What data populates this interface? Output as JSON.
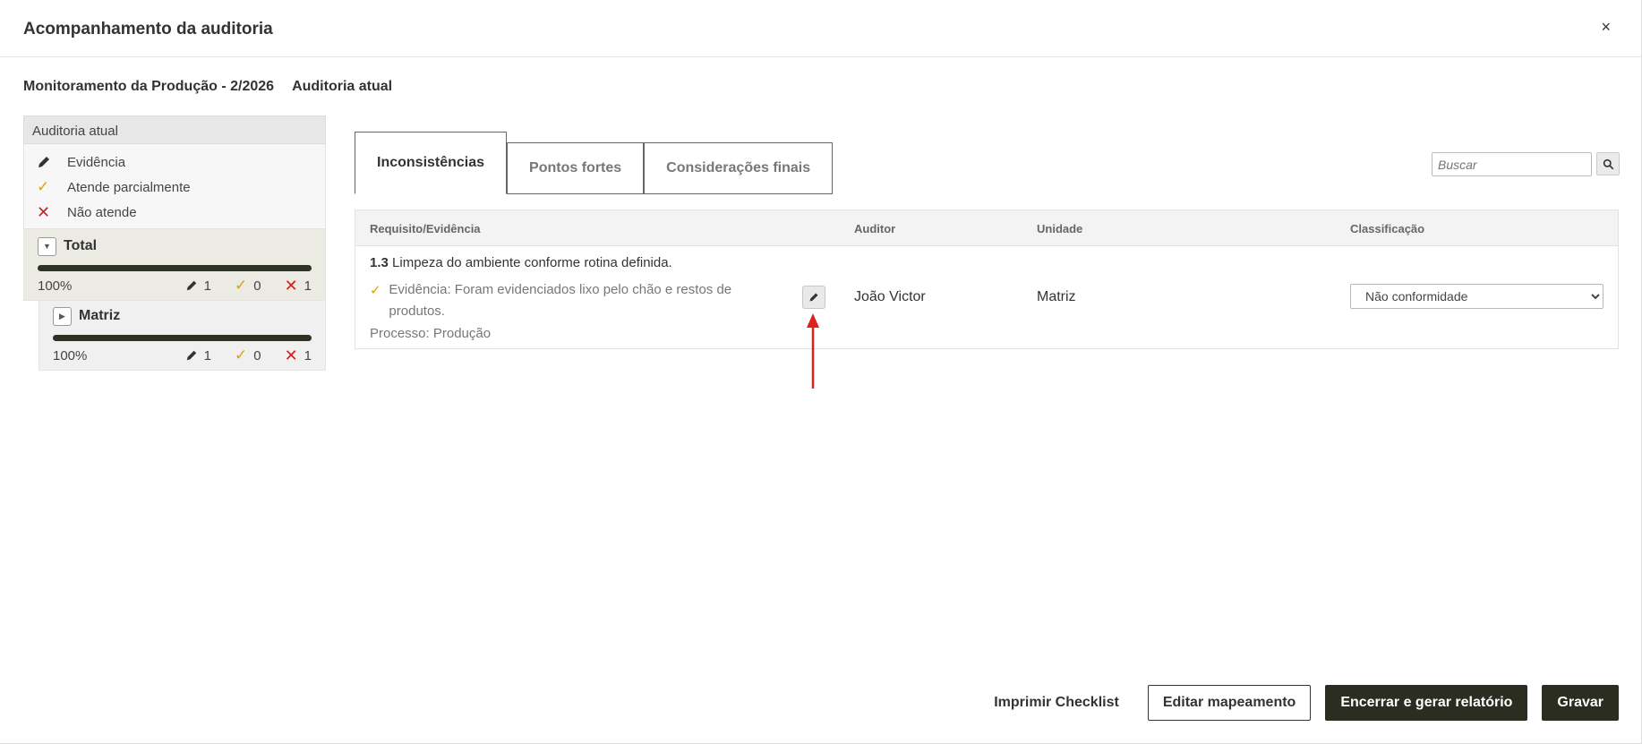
{
  "modal": {
    "title": "Acompanhamento da auditoria",
    "close_label": "×"
  },
  "breadcrumb": {
    "program": "Monitoramento da Produção - 2/2026",
    "audit": "Auditoria atual"
  },
  "left_panel": {
    "header": "Auditoria atual",
    "legend": [
      {
        "icon": "pencil-icon",
        "label": "Evidência"
      },
      {
        "icon": "check-icon",
        "label": "Atende parcialmente"
      },
      {
        "icon": "x-icon",
        "label": "Não atende"
      }
    ],
    "total": {
      "label": "Total",
      "percent": "100%",
      "progress": 1.0,
      "evidence_count": "1",
      "partial_count": "0",
      "fail_count": "1"
    },
    "matriz": {
      "label": "Matriz",
      "percent": "100%",
      "progress": 1.0,
      "evidence_count": "1",
      "partial_count": "0",
      "fail_count": "1"
    }
  },
  "tabs": [
    {
      "label": "Inconsistências",
      "active": true
    },
    {
      "label": "Pontos fortes",
      "active": false
    },
    {
      "label": "Considerações finais",
      "active": false
    }
  ],
  "search": {
    "placeholder": "Buscar"
  },
  "table": {
    "columns": [
      "Requisito/Evidência",
      "Auditor",
      "Unidade",
      "Classificação"
    ],
    "rows": [
      {
        "req_number": "1.3",
        "req_text": "Limpeza do ambiente conforme rotina definida.",
        "evidence": "Evidência: Foram evidenciados lixo pelo chão e restos de produtos.",
        "process": "Processo: Produção",
        "auditor": "João Victor",
        "unit": "Matriz",
        "classification": "Não conformidade"
      }
    ]
  },
  "footer": {
    "print_label": "Imprimir Checklist",
    "edit_map_label": "Editar mapeamento",
    "close_report_label": "Encerrar e gerar relatório",
    "save_label": "Gravar"
  },
  "colors": {
    "accent_dark": "#2b2d20",
    "fail_red": "#d21f1f",
    "partial_yellow": "#e0a400",
    "arrow_red": "#e02020"
  }
}
